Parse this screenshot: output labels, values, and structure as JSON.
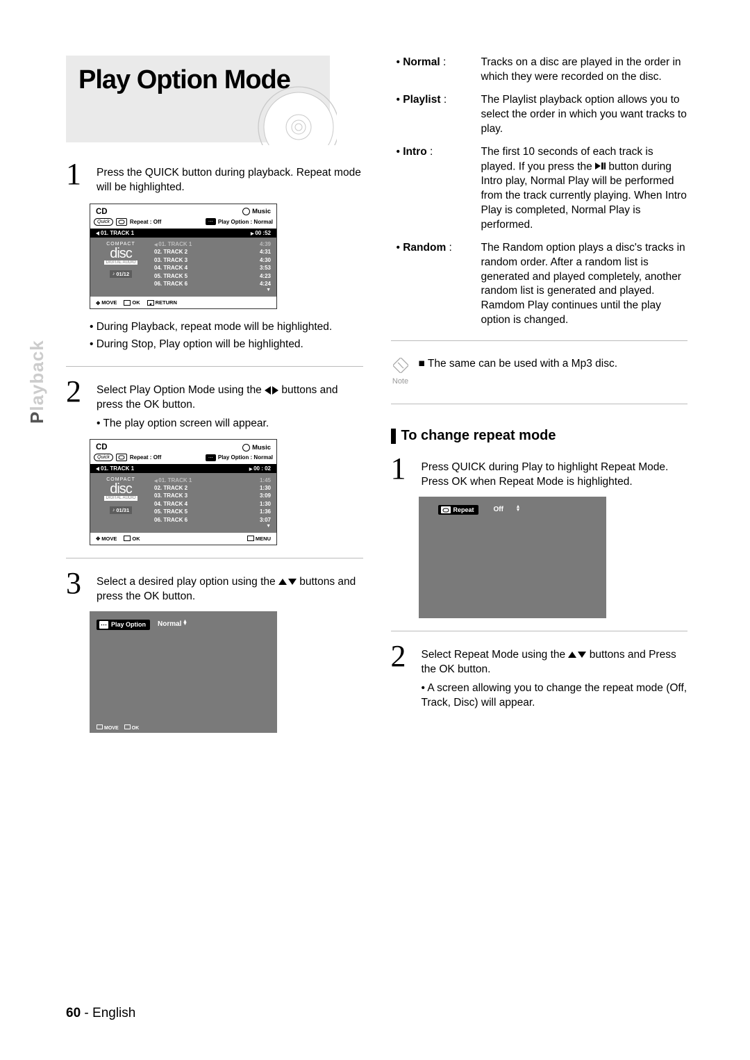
{
  "tab": {
    "dim": "P",
    "rest": "layback"
  },
  "title": "Play Option Mode",
  "left": {
    "step1": "Press the QUICK button during playback. Repeat mode will be highlighted.",
    "osd1": {
      "cd": "CD",
      "music": "Music",
      "quick": "Quick",
      "repeat": "Repeat : Off",
      "po": "Play Option : Normal",
      "now": "01. TRACK 1",
      "time": "00 :52",
      "counter": "01/12",
      "tracks": [
        [
          "01. TRACK 1",
          "4:39"
        ],
        [
          "02. TRACK 2",
          "4:31"
        ],
        [
          "03. TRACK 3",
          "4:30"
        ],
        [
          "04. TRACK 4",
          "3:53"
        ],
        [
          "05. TRACK 5",
          "4:23"
        ],
        [
          "06. TRACK 6",
          "4:24"
        ]
      ],
      "foot_move": "MOVE",
      "foot_ok": "OK",
      "foot_return": "RETURN"
    },
    "b1": "During Playback, repeat mode will be highlighted.",
    "b2": "During Stop, Play option will be highlighted.",
    "step2a": "Select Play Option Mode using the ",
    "step2b": " buttons and press the OK button.",
    "step2c": "The play option screen will appear.",
    "osd2": {
      "cd": "CD",
      "music": "Music",
      "quick": "Quick",
      "repeat": "Repeat : Off",
      "po": "Play Option : Normal",
      "now": "01. TRACK 1",
      "time": "00 : 02",
      "counter": "01/31",
      "tracks": [
        [
          "01. TRACK 1",
          "1:45"
        ],
        [
          "02. TRACK 2",
          "1:30"
        ],
        [
          "03. TRACK 3",
          "3:09"
        ],
        [
          "04. TRACK 4",
          "1:30"
        ],
        [
          "05. TRACK 5",
          "1:36"
        ],
        [
          "06. TRACK 6",
          "3:07"
        ]
      ],
      "foot_move": "MOVE",
      "foot_ok": "OK",
      "foot_menu": "MENU"
    },
    "step3a": "Select a desired play option using the ",
    "step3b": " buttons and press the OK button.",
    "popup1_label": "Play Option",
    "popup1_value": "Normal",
    "popup1_foot_move": "MOVE",
    "popup1_foot_ok": "OK"
  },
  "right": {
    "defs": [
      {
        "term": "Normal",
        "desc": "Tracks on a disc are played in the order in which they were recorded on the disc."
      },
      {
        "term": "Playlist",
        "desc": "The Playlist playback option allows you to select the order in which you want tracks to play."
      },
      {
        "term": "Intro",
        "desc_a": "The first 10 seconds of each track is played. If you press the ",
        "desc_b": " button during Intro play, Normal Play will be performed from the track currently playing. When Intro Play is completed, Normal Play is performed."
      },
      {
        "term": "Random",
        "desc": "The Random option plays a disc's tracks in random order. After a random list is generated and played completely, another random list is generated and played. Ramdom Play continues until the play option is changed."
      }
    ],
    "note": "The same can be used with a Mp3 disc.",
    "note_label": "Note",
    "subhead": "To change repeat mode",
    "r1": "Press QUICK during Play to highlight Repeat Mode. Press OK when Repeat Mode is highlighted.",
    "popup2_label": "Repeat",
    "popup2_value": "Off",
    "r2a": "Select Repeat Mode using the ",
    "r2b": " buttons and Press the OK button.",
    "r2c": "A screen allowing you to change the repeat mode (Off, Track, Disc) will appear."
  },
  "footer": {
    "page": "60",
    "sep": " - ",
    "lang": "English"
  }
}
